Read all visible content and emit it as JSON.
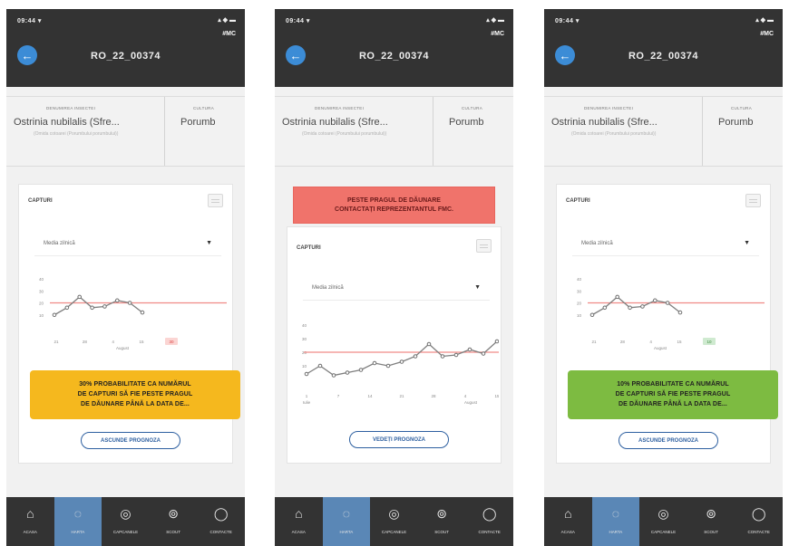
{
  "colors": {
    "header": "#333333",
    "accent": "#3c8cd6",
    "threshold": "#f08a86",
    "series": "#7f7f7f",
    "warn_bg": "#f0736b",
    "prob_yellow": "#f5b81e",
    "prob_green": "#7dbb41",
    "btn_border": "#2d5fa0",
    "nav_active": "#5a87b6"
  },
  "icons": {
    "back": "arrow-left-icon",
    "calendar": "calendar-icon",
    "dropdown": "chevron-down-icon",
    "home": "home-icon",
    "map": "map-icon",
    "traps": "trap-icon",
    "scout": "search-icon",
    "contacts": "chat-icon"
  },
  "screens": [
    {
      "status": {
        "time": "09:44 ▾",
        "icons": "▴ ◆ ▬"
      },
      "brand": "#MC",
      "title": "RO_22_00374",
      "info": {
        "insect_label": "DENUMIREA INSECTEI",
        "insect": "Ostrinia nubilalis (Sfre...",
        "insect_note": "(Omida cotoarei (Porumbului porumbului))",
        "crop_label": "CULTURA",
        "crop": "Porumb"
      },
      "captures": {
        "title": "CAPTURI",
        "select": "Media zilnică",
        "select_arrow": "▼"
      },
      "chart_data": {
        "type": "line",
        "y_ticks": [
          "40",
          "30",
          "20",
          "10"
        ],
        "x_ticks": [
          "21",
          "28",
          "4",
          "15"
        ],
        "x_month": "August",
        "badge": "30",
        "ylim": [
          0,
          40
        ],
        "threshold": 20,
        "series": [
          {
            "values": [
              [
                0,
                10
              ],
              [
                1,
                16
              ],
              [
                2,
                25
              ],
              [
                3,
                16
              ],
              [
                4,
                17
              ],
              [
                5,
                22
              ],
              [
                6,
                20
              ],
              [
                7,
                12
              ]
            ]
          }
        ]
      },
      "prob": "30% PROBABILITATE CA NUMĂRUL|DE CAPTURI SĂ FIE PESTE PRAGUL|DE DĂUNARE PÂNĂ LA DATA DE...",
      "button": "ASCUNDE PROGNOZA"
    },
    {
      "status": {
        "time": "09:44 ▾",
        "icons": "▴ ◆ ▬"
      },
      "brand": "#MC",
      "title": "RO_22_00374",
      "info": {
        "insect_label": "DENUMIREA INSECTEI",
        "insect": "Ostrinia nubilalis (Sfre...",
        "insect_note": "(Omida cotoarei (Porumbului porumbului))",
        "crop_label": "CULTURA",
        "crop": "Porumb"
      },
      "warning": {
        "line1": "PESTE PRAGUL DE DĂUNARE",
        "line2": "CONTACTAȚI REPREZENTANTUL FMC."
      },
      "captures": {
        "title": "CAPTURI",
        "select": "Media zilnică",
        "select_arrow": "▼"
      },
      "chart_data": {
        "type": "line",
        "y_ticks": [
          "40",
          "30",
          "20",
          "10"
        ],
        "x_ticks": [
          "1",
          "7",
          "14",
          "21",
          "28",
          "4",
          "15"
        ],
        "x_month_left": "Iulie",
        "x_month": "August",
        "ylim": [
          0,
          40
        ],
        "threshold": 20,
        "series": [
          {
            "values": [
              [
                0,
                4
              ],
              [
                1,
                10
              ],
              [
                2,
                3
              ],
              [
                3,
                5
              ],
              [
                4,
                7
              ],
              [
                5,
                12
              ],
              [
                6,
                10
              ],
              [
                7,
                13
              ],
              [
                8,
                17
              ],
              [
                9,
                26
              ],
              [
                10,
                17
              ],
              [
                11,
                18
              ],
              [
                12,
                22
              ],
              [
                13,
                19
              ],
              [
                14,
                28
              ]
            ]
          }
        ]
      },
      "button": "VEDEȚI PROGNOZA"
    },
    {
      "status": {
        "time": "09:44 ▾",
        "icons": "▴ ◆ ▬"
      },
      "brand": "#MC",
      "title": "RO_22_00374",
      "info": {
        "insect_label": "DENUMIREA INSECTEI",
        "insect": "Ostrinia nubilalis (Sfre...",
        "insect_note": "(Omida cotoarei (Porumbului porumbului))",
        "crop_label": "CULTURA",
        "crop": "Porumb"
      },
      "captures": {
        "title": "CAPTURI",
        "select": "Media zilnică",
        "select_arrow": "▼"
      },
      "chart_data": {
        "type": "line",
        "y_ticks": [
          "40",
          "30",
          "20",
          "10"
        ],
        "x_ticks": [
          "21",
          "28",
          "4",
          "15"
        ],
        "x_month": "August",
        "badge": "10",
        "ylim": [
          0,
          40
        ],
        "threshold": 20,
        "series": [
          {
            "values": [
              [
                0,
                10
              ],
              [
                1,
                16
              ],
              [
                2,
                25
              ],
              [
                3,
                16
              ],
              [
                4,
                17
              ],
              [
                5,
                22
              ],
              [
                6,
                20
              ],
              [
                7,
                12
              ]
            ]
          }
        ]
      },
      "prob": "10% PROBABILITATE CA NUMĂRUL|DE CAPTURI SĂ FIE PESTE PRAGUL|DE DĂUNARE PÂNĂ LA DATA DE...",
      "button": "ASCUNDE PROGNOZA"
    }
  ],
  "nav": [
    {
      "label": "ACASA",
      "icon": "⌂",
      "active": false
    },
    {
      "label": "HARTA",
      "icon": "◌",
      "active": true
    },
    {
      "label": "CAPCANELE",
      "icon": "◎",
      "active": false
    },
    {
      "label": "SCOUT",
      "icon": "⊚",
      "active": false
    },
    {
      "label": "CONTACTE",
      "icon": "◯",
      "active": false
    }
  ]
}
